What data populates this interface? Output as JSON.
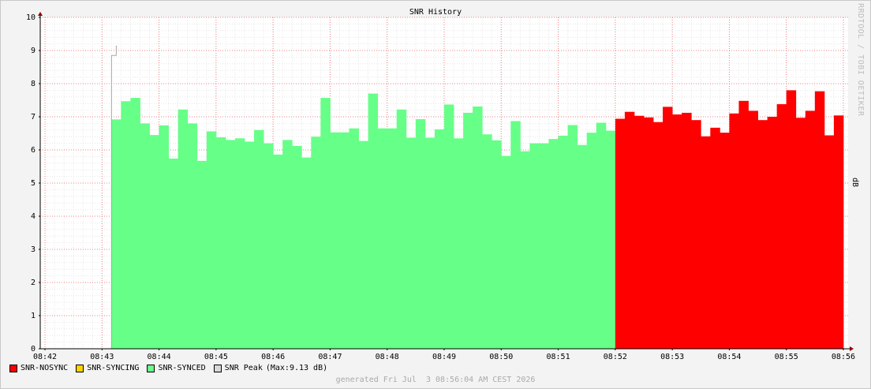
{
  "window": {
    "title": "SNR History"
  },
  "watermark": "RRDTOOL / TOBI OETIKER",
  "footer": {
    "generated": "generated Fri Jul  3 08:56:04 AM CEST 2026"
  },
  "colors": {
    "background": "#F3F3F3",
    "canvas": "#FFFFFF",
    "nosync": "#FF0000",
    "syncing": "#FFD200",
    "synced": "#66FF88",
    "peak": "#D8D8D8",
    "grid_major": "#F08080",
    "grid_minor": "#E6E6E6"
  },
  "legend": {
    "items": [
      {
        "label": "SNR-NOSYNC",
        "color": "#FF0000"
      },
      {
        "label": "SNR-SYNCING",
        "color": "#FFD200"
      },
      {
        "label": "SNR-SYNCED",
        "color": "#66FF88"
      },
      {
        "label": "SNR Peak",
        "color": "#D8D8D8"
      }
    ],
    "peak_note": "(Max:9.13 dB)"
  },
  "chart_data": {
    "type": "area",
    "title": "SNR History",
    "ylabel": "dB",
    "xlabel": "",
    "ylim": [
      0,
      10
    ],
    "yticks": [
      0,
      1,
      2,
      3,
      4,
      5,
      6,
      7,
      8,
      9,
      10
    ],
    "xlim": [
      "08:41:55",
      "08:56:05"
    ],
    "xticks": [
      "08:42",
      "08:43",
      "08:44",
      "08:45",
      "08:46",
      "08:47",
      "08:48",
      "08:49",
      "08:50",
      "08:51",
      "08:52",
      "08:53",
      "08:54",
      "08:55",
      "08:56"
    ],
    "x_start": "08:43:10",
    "x_step_seconds": 10,
    "grid": true,
    "legend_position": "bottom-left",
    "series": [
      {
        "name": "SNR-SYNCED",
        "color": "#66FF88",
        "start": "08:43:10",
        "values": [
          6.92,
          7.47,
          7.57,
          6.8,
          6.45,
          6.74,
          5.74,
          7.22,
          6.8,
          5.67,
          6.56,
          6.38,
          6.3,
          6.35,
          6.25,
          6.6,
          6.2,
          5.86,
          6.3,
          6.12,
          5.77,
          6.4,
          7.57,
          6.53,
          6.53,
          6.65,
          6.27,
          7.7,
          6.65,
          6.65,
          7.22,
          6.37,
          6.93,
          6.37,
          6.62,
          7.37,
          6.35,
          7.12,
          7.31,
          6.47,
          6.29,
          5.82,
          6.87,
          5.96,
          6.2,
          6.2,
          6.33,
          6.43,
          6.75,
          6.15,
          6.52,
          6.82,
          6.58
        ]
      },
      {
        "name": "SNR-NOSYNC",
        "color": "#FF0000",
        "start": "08:52:00",
        "values": [
          6.94,
          7.15,
          7.03,
          6.98,
          6.84,
          7.3,
          7.07,
          7.12,
          6.9,
          6.41,
          6.67,
          6.52,
          7.1,
          7.48,
          7.18,
          6.9,
          7.0,
          7.38,
          7.8,
          6.97,
          7.18,
          7.77,
          6.44,
          7.04
        ]
      },
      {
        "name": "SNR Peak",
        "color": "#D8D8D8",
        "points": [
          {
            "x": "08:43:10",
            "y": 8.85
          },
          {
            "x": "08:43:15",
            "y": 9.13
          }
        ]
      }
    ]
  }
}
